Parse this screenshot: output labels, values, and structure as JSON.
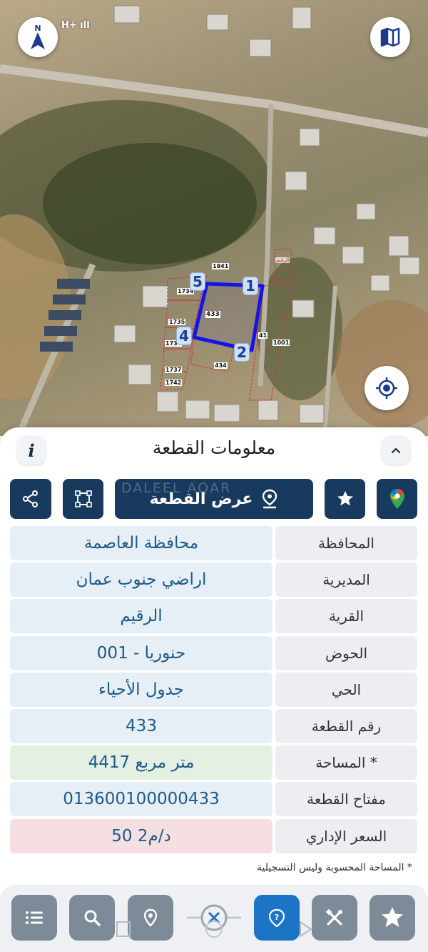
{
  "status_bar": {
    "text": "H+ ıll"
  },
  "map": {
    "parcel_number": "433",
    "vertex_labels": [
      "1",
      "2",
      "4",
      "5"
    ],
    "neighbor_labels": [
      "1841",
      "1734",
      "1735",
      "1736",
      "1737",
      "1742",
      "434",
      "41",
      "1001",
      "الرقيم"
    ]
  },
  "panel": {
    "title": "معلومات القطعة",
    "show_parcel_label": "عرض القطعة",
    "watermark": "DALEEL AQAR",
    "rows": [
      {
        "label": "المحافظة",
        "value": "محافظة العاصمة",
        "bg": "#e6eef6"
      },
      {
        "label": "المديرية",
        "value": "اراضي جنوب عمان",
        "bg": "#e6eef6"
      },
      {
        "label": "القرية",
        "value": "الرقيم",
        "bg": "#e6eef6"
      },
      {
        "label": "الحوض",
        "value": "حنوريا - 001",
        "bg": "#e6eef6"
      },
      {
        "label": "الحي",
        "value": "جدول الأحياء",
        "bg": "#e6eef6"
      },
      {
        "label": "رقم القطعة",
        "value": "433",
        "bg": "#e6eef6"
      },
      {
        "label": "المساحة *",
        "value": "4417  متر مربع",
        "bg": "#e4f1e2"
      },
      {
        "label": "مفتاح القطعة",
        "value": "013600100000433",
        "bg": "#e6eef6"
      },
      {
        "label": "السعر الإداري",
        "value": "50 د/م2",
        "bg": "#f6dfe0"
      }
    ],
    "footnote": "* المساحة المحسوبة وليس التسجيلية"
  },
  "colors": {
    "primary": "#173a5e",
    "value_text": "#1d5a8a",
    "nav_active": "#1b74c4",
    "nav_button": "#7d8a97",
    "parcel_outline": "#1414e6"
  },
  "icons": {
    "compass": "compass-icon",
    "map_layers": "map-layers-icon",
    "locate": "locate-icon",
    "info": "info-icon",
    "collapse": "chevron-up-icon",
    "share": "share-icon",
    "polygon": "polygon-icon",
    "pin": "pin-icon",
    "star": "star-icon",
    "google_maps": "google-maps-icon",
    "list": "list-icon",
    "search": "search-icon",
    "location_pin": "location-pin-icon",
    "help": "help-icon",
    "tools": "tools-icon",
    "favorite": "favorite-icon"
  }
}
